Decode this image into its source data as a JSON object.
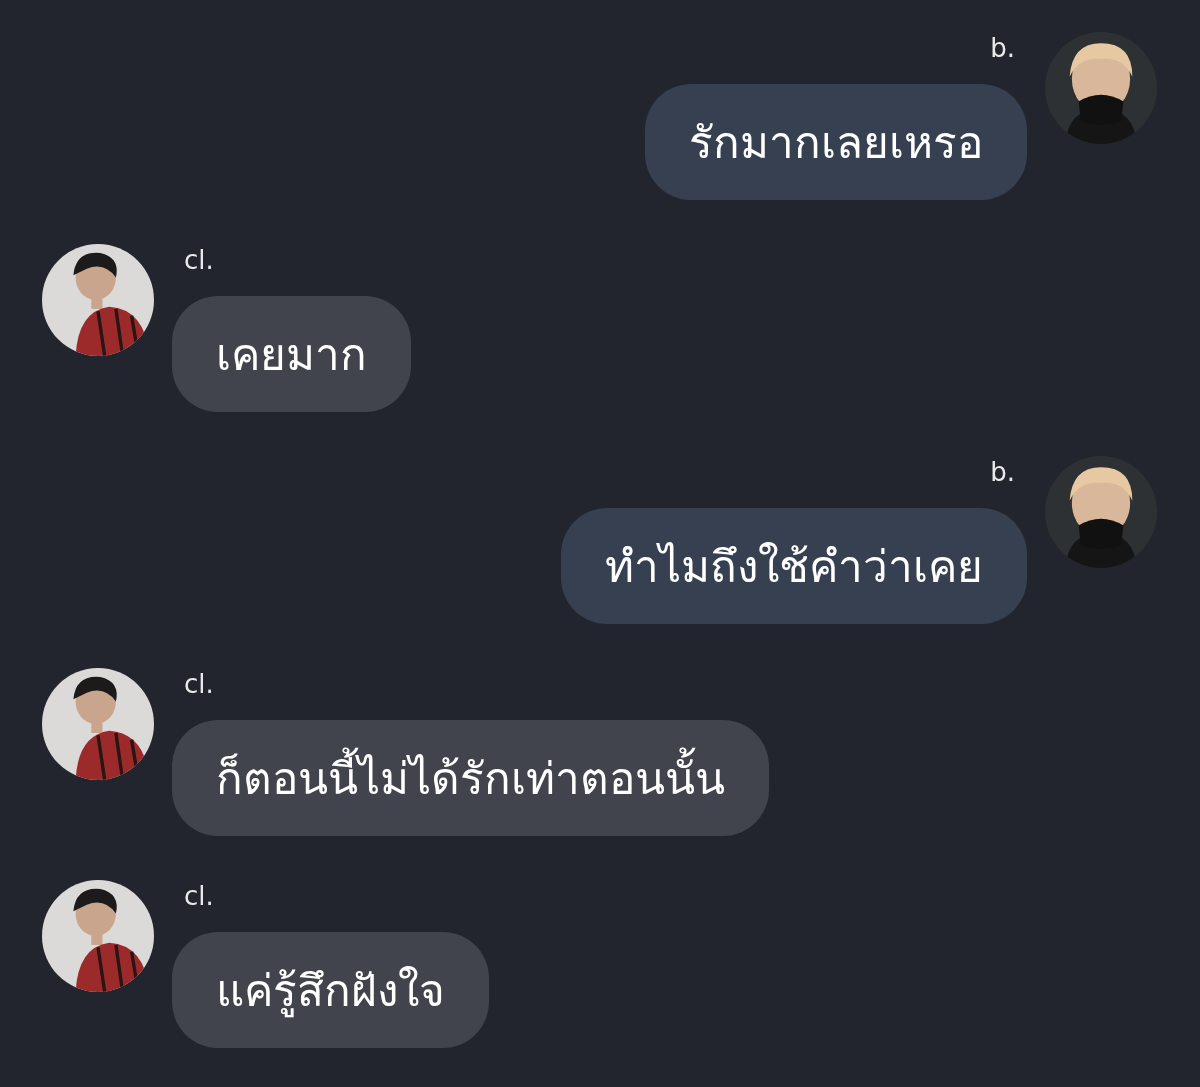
{
  "messages": [
    {
      "kind": "outgoing",
      "sender": "b.",
      "text": "รักมากเลยเหรอ"
    },
    {
      "kind": "incoming",
      "sender": "cl.",
      "text": "เคยมาก"
    },
    {
      "kind": "outgoing",
      "sender": "b.",
      "text": "ทำไมถึงใช้คำว่าเคย"
    },
    {
      "kind": "incoming",
      "sender": "cl.",
      "text": "ก็ตอนนี้ไม่ได้รักเท่าตอนนั้น"
    },
    {
      "kind": "incoming",
      "sender": "cl.",
      "text": "แค่รู้สึกฝังใจ"
    }
  ]
}
